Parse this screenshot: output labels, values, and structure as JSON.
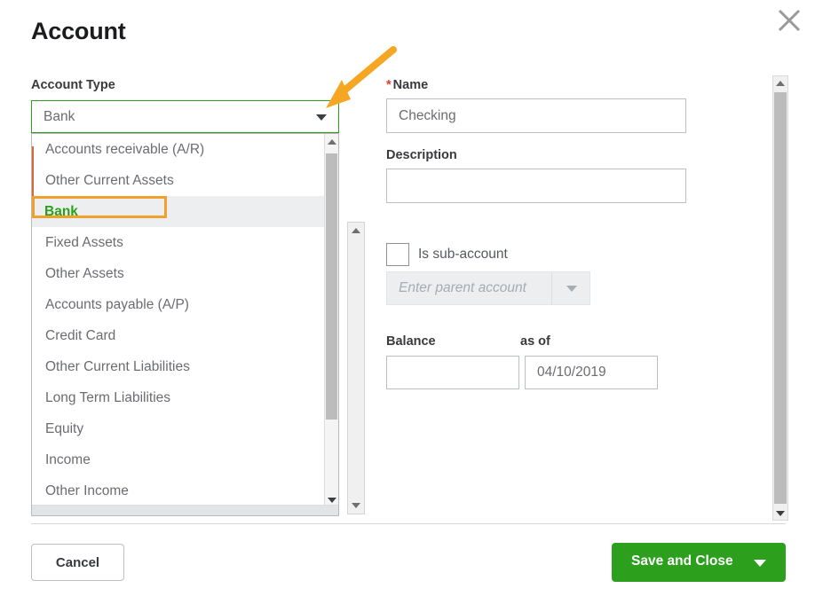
{
  "dialog": {
    "title": "Account",
    "close_icon": "close-icon"
  },
  "account_type": {
    "label": "Account Type",
    "selected_value": "Bank",
    "caret_icon": "chevron-down-icon",
    "options": [
      "Accounts receivable (A/R)",
      "Other Current Assets",
      "Bank",
      "Fixed Assets",
      "Other Assets",
      "Accounts payable (A/P)",
      "Credit Card",
      "Other Current Liabilities",
      "Long Term Liabilities",
      "Equity",
      "Income",
      "Other Income"
    ],
    "selected_index": 2,
    "highlight_color": "#f0a02c",
    "selected_text_color": "#2ca01c"
  },
  "name_field": {
    "label": "Name",
    "required_marker": "*",
    "value": "Checking",
    "placeholder": ""
  },
  "description_field": {
    "label": "Description",
    "value": "",
    "placeholder": ""
  },
  "sub_account": {
    "label": "Is sub-account",
    "checked": false,
    "parent_placeholder": "Enter parent account",
    "parent_value": "",
    "caret_icon": "chevron-down-icon"
  },
  "balance_field": {
    "label": "Balance",
    "value": "",
    "placeholder": ""
  },
  "as_of_field": {
    "label": "as of",
    "value": "04/10/2019",
    "placeholder": ""
  },
  "footer": {
    "cancel_label": "Cancel",
    "save_label": "Save and Close",
    "save_caret_icon": "chevron-down-icon",
    "save_color": "#2ca01c"
  },
  "annotation": {
    "arrow_icon": "arrow-pointer-icon",
    "color": "#f5a623"
  },
  "scrollbars": {
    "up_icon": "scroll-up-arrow-icon",
    "down_icon": "scroll-down-arrow-icon"
  }
}
